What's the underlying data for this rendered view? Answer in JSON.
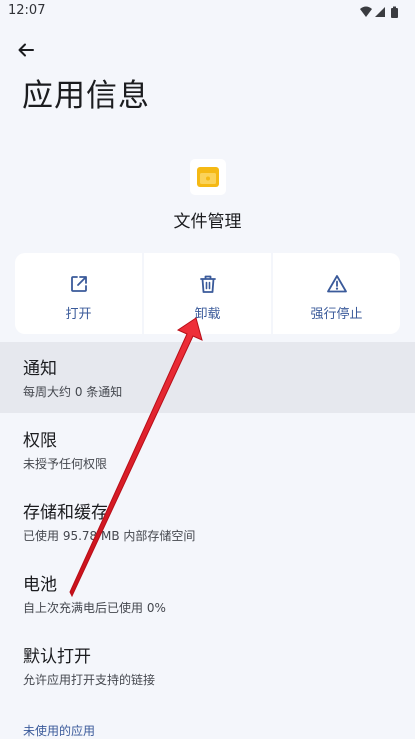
{
  "status_bar": {
    "time": "12:07",
    "icons": [
      "wifi-icon",
      "signal-icon",
      "battery-icon"
    ]
  },
  "header": {
    "back_icon": "arrow-back-icon",
    "title": "应用信息"
  },
  "app": {
    "name": "文件管理",
    "icon": "file-manager-app-icon",
    "icon_color": "#f5b914"
  },
  "actions": [
    {
      "label": "打开",
      "icon": "open-external-icon"
    },
    {
      "label": "卸载",
      "icon": "trash-icon"
    },
    {
      "label": "强行停止",
      "icon": "warning-triangle-icon"
    }
  ],
  "settings": [
    {
      "title": "通知",
      "subtitle": "每周大约 0 条通知"
    },
    {
      "title": "权限",
      "subtitle": "未授予任何权限"
    },
    {
      "title": "存储和缓存",
      "subtitle": "已使用 95.78 MB 内部存储空间"
    },
    {
      "title": "电池",
      "subtitle": "自上次充满电后已使用 0%"
    },
    {
      "title": "默认打开",
      "subtitle": "允许应用打开支持的链接"
    }
  ],
  "section_header": "未使用的应用",
  "colors": {
    "accent": "#3a5a9a",
    "background": "#f4f6fb",
    "annotation_arrow": "#e8202a"
  }
}
